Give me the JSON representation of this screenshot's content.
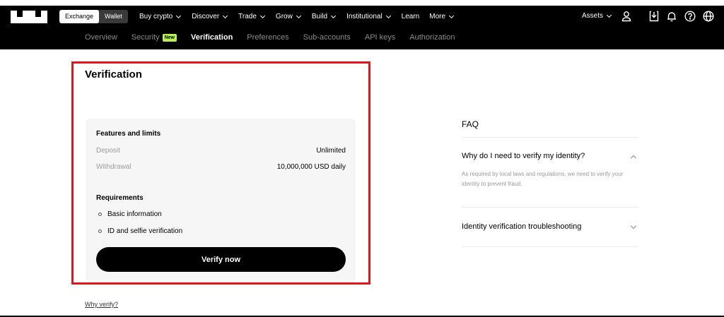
{
  "header": {
    "logo": "OKX",
    "toggle": {
      "exchange": "Exchange",
      "wallet": "Wallet"
    },
    "nav": [
      {
        "label": "Buy crypto",
        "dropdown": true
      },
      {
        "label": "Discover",
        "dropdown": true
      },
      {
        "label": "Trade",
        "dropdown": true
      },
      {
        "label": "Grow",
        "dropdown": true
      },
      {
        "label": "Build",
        "dropdown": true
      },
      {
        "label": "Institutional",
        "dropdown": true
      },
      {
        "label": "Learn",
        "dropdown": false
      },
      {
        "label": "More",
        "dropdown": true
      }
    ],
    "assets_label": "Assets",
    "icons": [
      "user-icon",
      "download-icon",
      "bell-icon",
      "help-icon",
      "globe-icon"
    ]
  },
  "subnav": {
    "tabs": [
      "Overview",
      "Security",
      "Verification",
      "Preferences",
      "Sub-accounts",
      "API keys",
      "Authorization"
    ],
    "active": "Verification",
    "new_badge": "New"
  },
  "main": {
    "title": "Verification",
    "features_title": "Features and limits",
    "deposit_label": "Deposit",
    "deposit_value": "Unlimited",
    "withdrawal_label": "Withdrawal",
    "withdrawal_value": "10,000,000 USD daily",
    "requirements_title": "Requirements",
    "requirements": [
      "Basic information",
      "ID and selfie verification"
    ],
    "verify_button": "Verify now",
    "why_link": "Why verify?"
  },
  "faq": {
    "title": "FAQ",
    "q1": "Why do I need to verify my identity?",
    "a1": "As required by local laws and regulations, we need to verify your identity to prevent fraud.",
    "q2": "Identity verification troubleshooting"
  },
  "colors": {
    "highlight": "#e1161c",
    "badge": "#b7f24d"
  }
}
